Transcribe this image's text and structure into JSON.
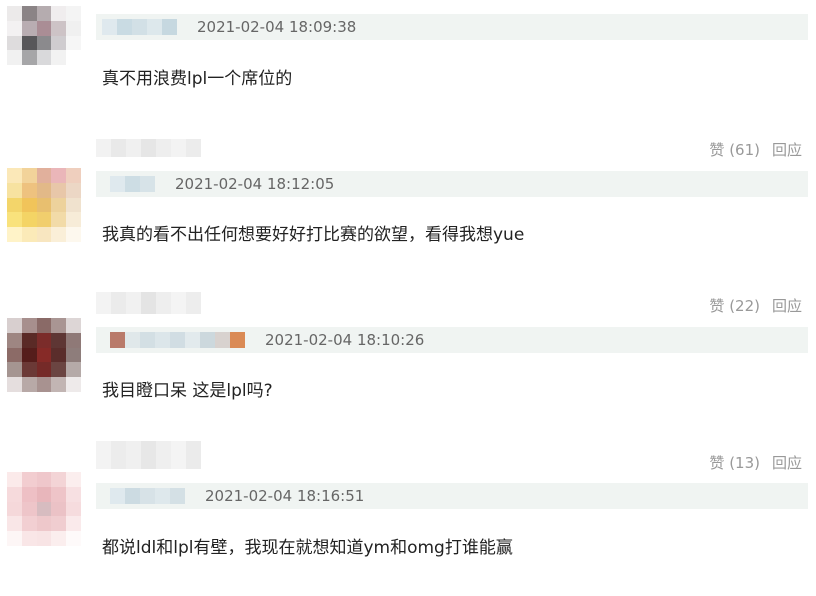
{
  "comments": [
    {
      "time": "2021-02-04 18:09:38",
      "text": "真不用浪费lpl一个席位的",
      "avatar_colors": [
        "#eceaea",
        "#8b8486",
        "#b5acaf",
        "#f0edee",
        "#f4f4f4",
        "#f3f1f2",
        "#b9adb2",
        "#aa8d95",
        "#cdc3c6",
        "#f0f0f0",
        "#dedcdd",
        "#58575a",
        "#8b8a8d",
        "#cfcccf",
        "#f6f6f6",
        "#f1f1f1",
        "#a6a6a8",
        "#d9d9db",
        "#f2f2f2",
        "#ffffff",
        "#ffffff",
        "#ffffff",
        "#ffffff",
        "#ffffff",
        "#ffffff"
      ]
    },
    {
      "likes": "赞 (61)",
      "reply": "回应",
      "time": "2021-02-04 18:12:05",
      "text": "我真的看不出任何想要好好打比赛的欲望，看得我想yue",
      "avatar_colors": [
        "#fbe8b8",
        "#f2d39a",
        "#e1b09c",
        "#eab6b9",
        "#efcfbe",
        "#f7e2a0",
        "#eec27f",
        "#e2b988",
        "#e8c7a9",
        "#ecd7c5",
        "#f3d56a",
        "#f1c45a",
        "#e8bf6f",
        "#edd29c",
        "#f0e2ce",
        "#f9e27c",
        "#f4d465",
        "#f1ce6d",
        "#f2dba8",
        "#f7ecd8",
        "#fff3c8",
        "#fbeab8",
        "#f8e6c0",
        "#faefd8",
        "#fdf8ee"
      ]
    },
    {
      "likes": "赞 (22)",
      "reply": "回应",
      "time": "2021-02-04 18:10:26",
      "text": "我目瞪口呆 这是lpl吗?",
      "avatar_colors": [
        "#d8cfcf",
        "#a78f8d",
        "#8a6a67",
        "#a99593",
        "#ddd6d6",
        "#9e8682",
        "#5a2a26",
        "#7b2c2a",
        "#5e3634",
        "#8f7977",
        "#8c6b67",
        "#551d1b",
        "#862a27",
        "#5a2d2b",
        "#8e7d7b",
        "#a59591",
        "#6b3936",
        "#752a28",
        "#6b4542",
        "#b5aaa8",
        "#e5dede",
        "#b8a9a7",
        "#a89290",
        "#c2b5b3",
        "#eeeaea"
      ]
    },
    {
      "likes": "赞 (13)",
      "reply": "回应",
      "time": "2021-02-04 18:16:51",
      "text": "都说ldl和lpl有壁，我现在就想知道ym和omg打谁能赢",
      "avatar_colors": [
        "#fbeaea",
        "#f2cdd0",
        "#efc7cb",
        "#f3d4d6",
        "#fbeeee",
        "#f6dadc",
        "#eec0c5",
        "#e8b6bb",
        "#eec4c8",
        "#f7e0e2",
        "#f5d8da",
        "#eec5c9",
        "#d7bcc0",
        "#ebc2c6",
        "#f6dcde",
        "#f9e6e7",
        "#f2cfd2",
        "#eec8cb",
        "#f0cdd0",
        "#faeaeb",
        "#fdf6f6",
        "#f9e6e7",
        "#f8e4e5",
        "#fbeeee",
        "#fefafa"
      ]
    }
  ]
}
